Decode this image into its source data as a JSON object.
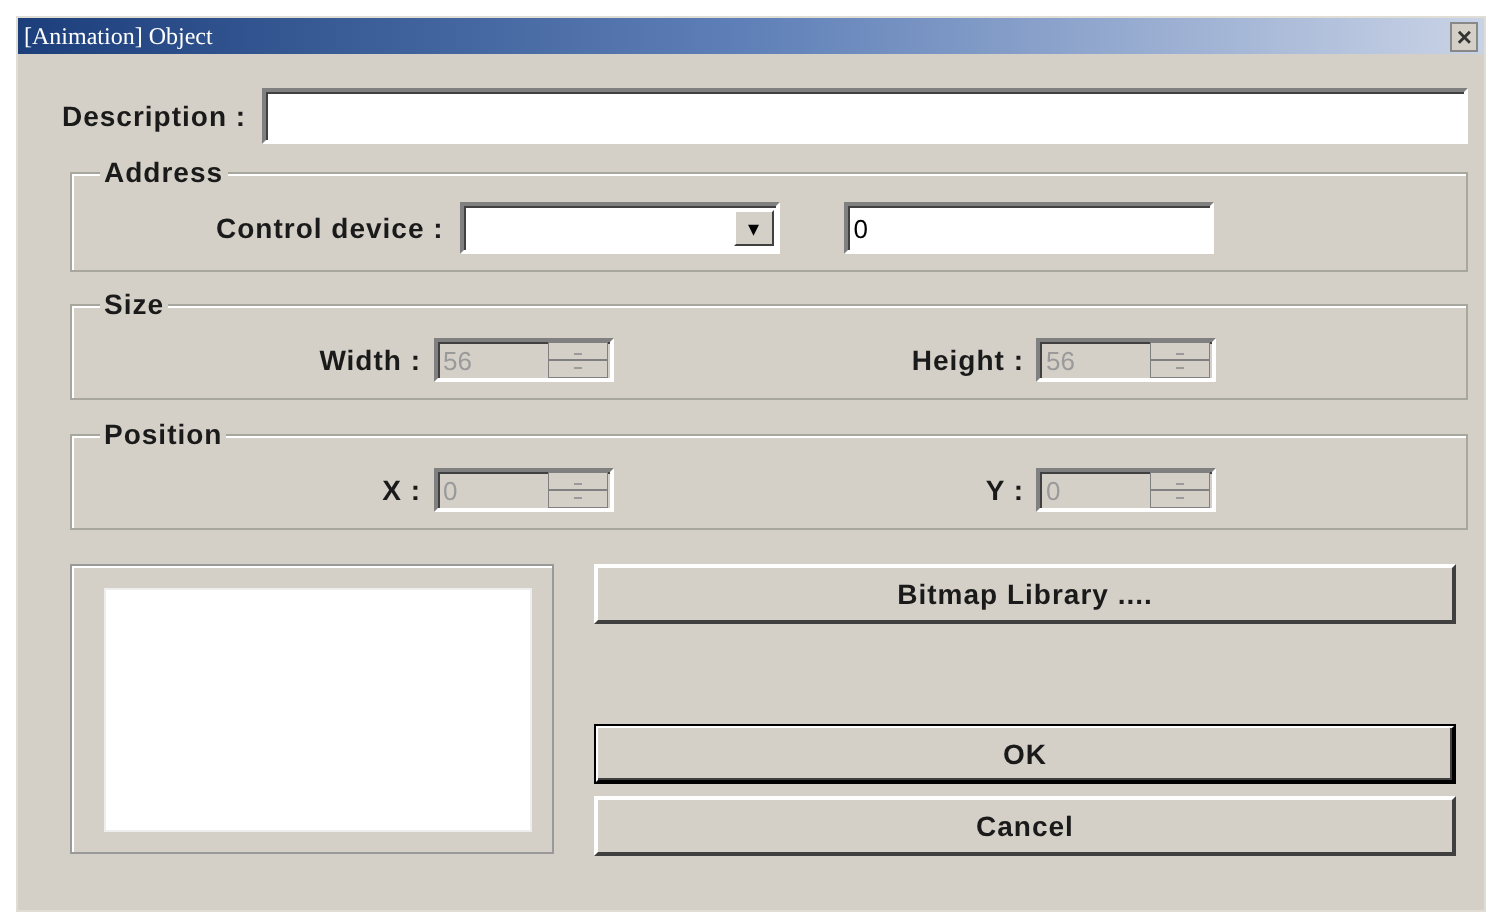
{
  "window": {
    "title": "[Animation] Object",
    "close": "×"
  },
  "description": {
    "label": "Description :"
  },
  "address": {
    "title": "Address",
    "label": "Control device :",
    "caret": "▾",
    "value": "0"
  },
  "size": {
    "title": "Size",
    "fields": [
      {
        "label": "Width :",
        "value": "56",
        "disabled": true
      },
      {
        "label": "Height :",
        "value": "56",
        "disabled": true
      }
    ]
  },
  "position": {
    "title": "Position",
    "fields": [
      {
        "label": "X :",
        "value": "0",
        "disabled": true
      },
      {
        "label": "Y :",
        "value": "0",
        "disabled": true
      }
    ]
  },
  "buttons": [
    {
      "label": "Bitmap Library ....",
      "default": false
    },
    {
      "label": "OK",
      "default": true
    },
    {
      "label": "Cancel",
      "default": false
    }
  ]
}
